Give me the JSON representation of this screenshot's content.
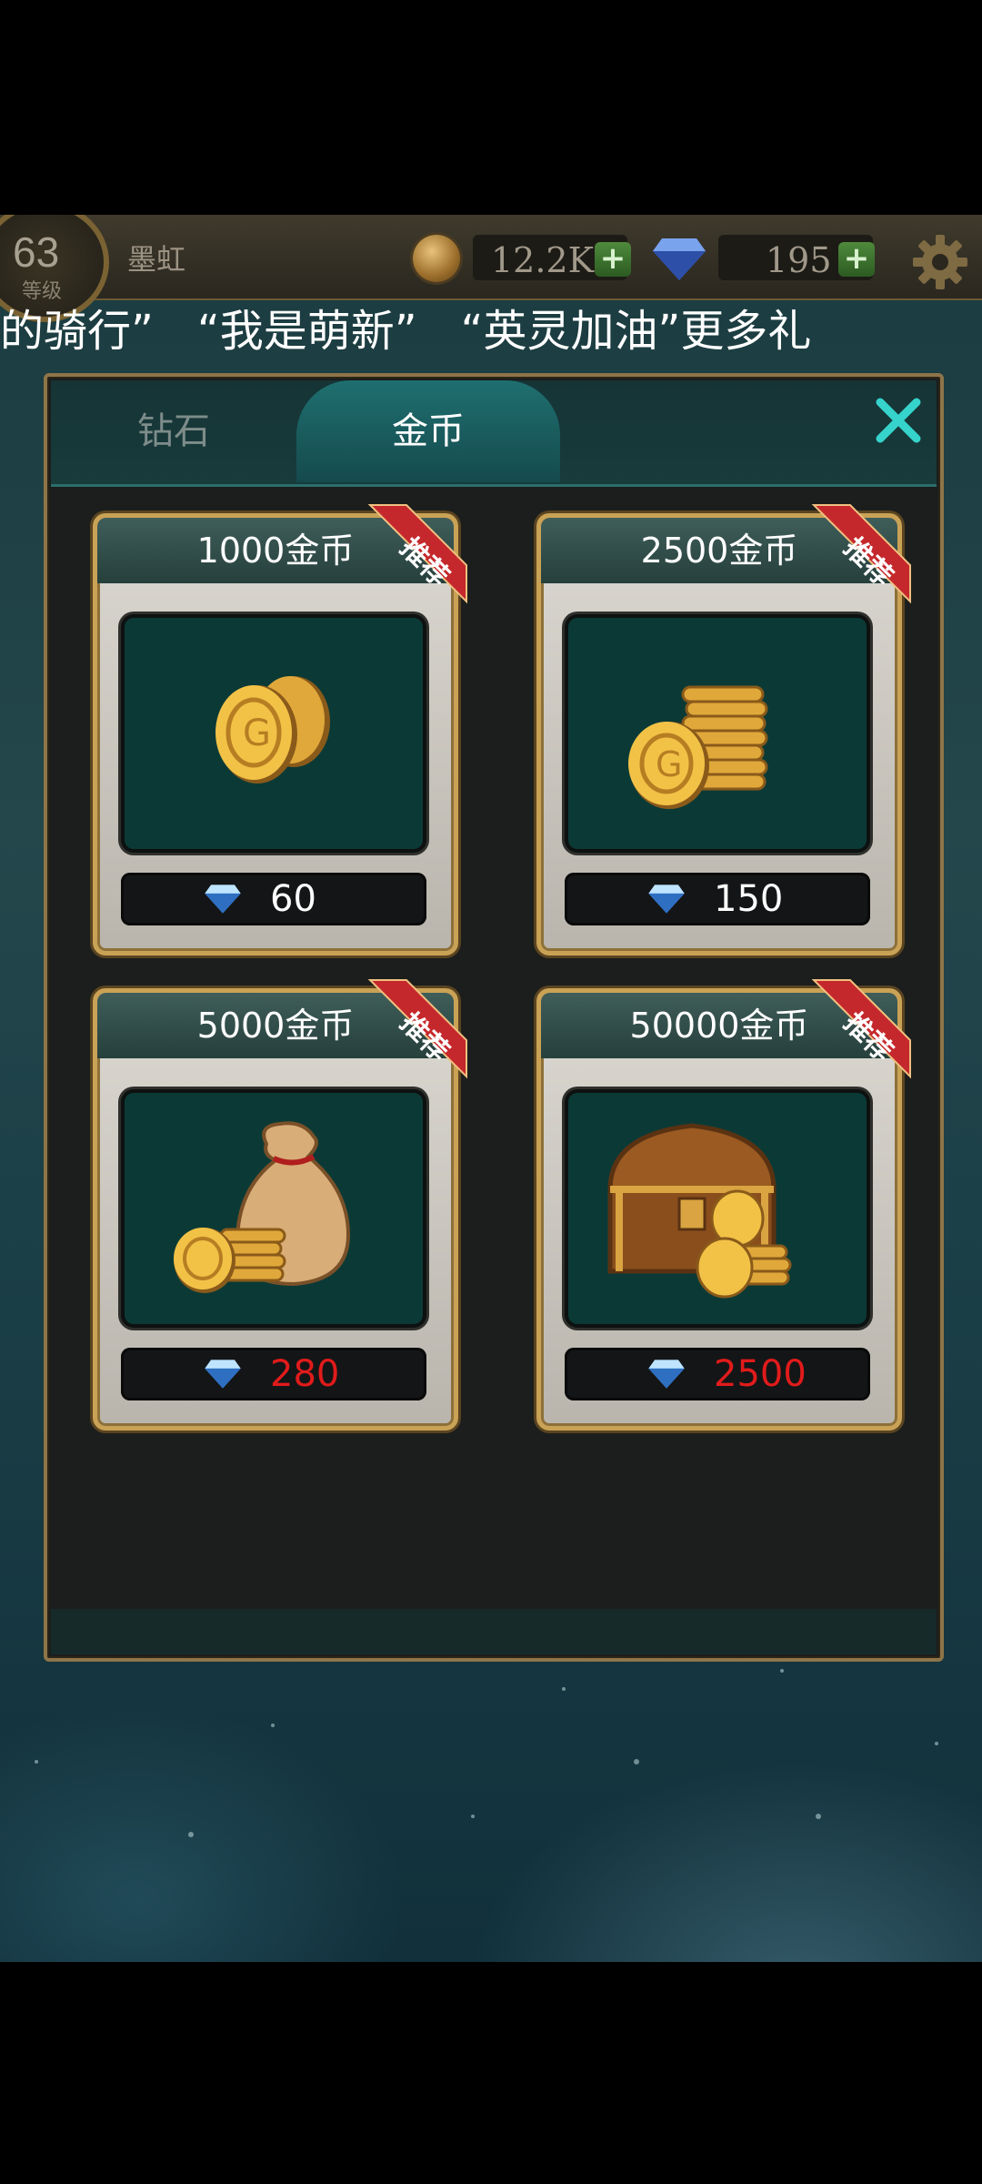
{
  "hud": {
    "level": "63",
    "level_caption": "等级",
    "player_name": "墨虹",
    "gold": "12.2K",
    "diamonds": "195",
    "plus_symbol": "+"
  },
  "marquee": {
    "text": "的骑行”　“我是萌新”　“英灵加油”更多礼"
  },
  "tabs": [
    {
      "label": "钻石",
      "active": false
    },
    {
      "label": "金币",
      "active": true
    }
  ],
  "packs": [
    {
      "title": "1000金币",
      "price": "60",
      "ribbon": "推荐",
      "art": "coins-small-icon",
      "price_color": "#ffffff"
    },
    {
      "title": "2500金币",
      "price": "150",
      "ribbon": "推荐",
      "art": "coin-stack-icon",
      "price_color": "#ffffff"
    },
    {
      "title": "5000金币",
      "price": "280",
      "ribbon": "推荐",
      "art": "coin-bag-icon",
      "price_color": "#e11b1b"
    },
    {
      "title": "50000金币",
      "price": "2500",
      "ribbon": "推荐",
      "art": "treasure-chest-icon",
      "price_color": "#e11b1b"
    }
  ],
  "colors": {
    "accent_teal": "#1f6f70",
    "gold_border": "#c9a255",
    "price_red": "#e11b1b",
    "ribbon_red": "#c5282c"
  }
}
